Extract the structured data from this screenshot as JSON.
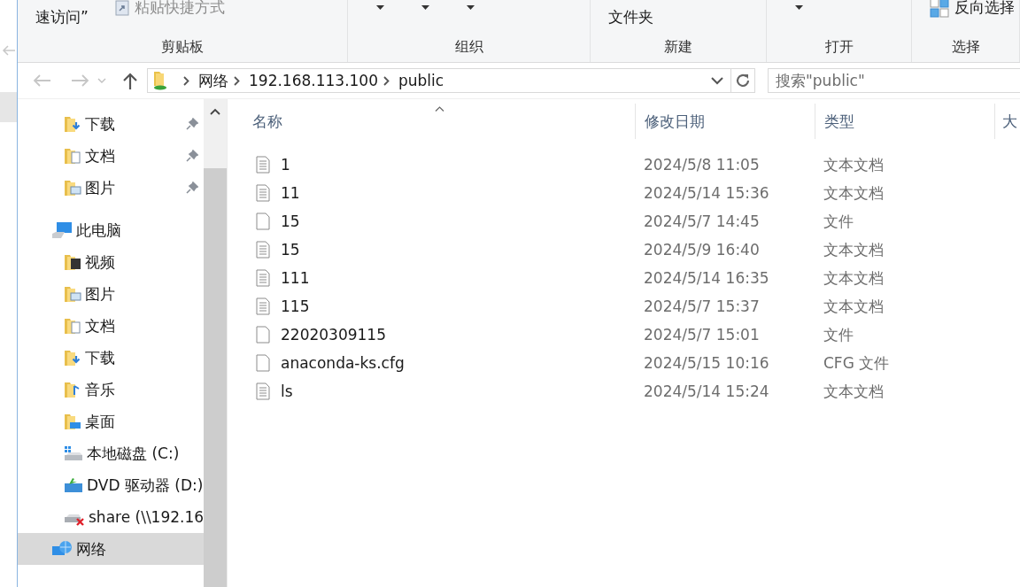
{
  "ribbon": {
    "groups": [
      {
        "label": "剪贴板",
        "items": [
          {
            "kind": "text",
            "label": "速访问”",
            "disabled": false
          },
          {
            "kind": "shortcut",
            "label": "粘贴快捷方式",
            "disabled": true
          }
        ]
      },
      {
        "label": "组织",
        "items": [
          {
            "kind": "caret"
          },
          {
            "kind": "caret"
          },
          {
            "kind": "caret"
          }
        ]
      },
      {
        "label": "新建",
        "items": [
          {
            "kind": "text",
            "label": "文件夹",
            "disabled": false
          }
        ]
      },
      {
        "label": "打开",
        "items": [
          {
            "kind": "caret"
          }
        ]
      },
      {
        "label": "选择",
        "items": [
          {
            "kind": "invert",
            "label": "反向选择",
            "disabled": false
          }
        ]
      }
    ]
  },
  "address": {
    "back_disabled": true,
    "forward_disabled": true,
    "crumbs": [
      "网络",
      "192.168.113.100",
      "public"
    ],
    "search": {
      "placeholder": "搜索\"public\""
    }
  },
  "nav": {
    "quick_access": [
      {
        "label": "下载",
        "kind": "download",
        "pinned": true
      },
      {
        "label": "文档",
        "kind": "document",
        "pinned": true
      },
      {
        "label": "图片",
        "kind": "picture",
        "pinned": true
      }
    ],
    "tree": [
      {
        "label": "此电脑",
        "kind": "computer",
        "selected": false,
        "children": [
          {
            "label": "视频",
            "kind": "video",
            "selected": false
          },
          {
            "label": "图片",
            "kind": "picture",
            "selected": false
          },
          {
            "label": "文档",
            "kind": "document",
            "selected": false
          },
          {
            "label": "下载",
            "kind": "download",
            "selected": false
          },
          {
            "label": "音乐",
            "kind": "music",
            "selected": false
          },
          {
            "label": "桌面",
            "kind": "desktop",
            "selected": false
          },
          {
            "label": "本地磁盘 (C:)",
            "kind": "drive",
            "selected": false
          },
          {
            "label": "DVD 驱动器 (D:)",
            "kind": "dvd",
            "selected": false
          },
          {
            "label": "share (\\\\192.16",
            "kind": "share",
            "selected": false
          }
        ]
      },
      {
        "label": "网络",
        "kind": "network",
        "selected": true
      }
    ]
  },
  "table": {
    "columns": [
      "名称",
      "修改日期",
      "类型",
      "大"
    ],
    "rows": [
      {
        "kind": "text",
        "name": "1",
        "date": "2024/5/8 11:05",
        "type": "文本文档"
      },
      {
        "kind": "text",
        "name": "11",
        "date": "2024/5/14 15:36",
        "type": "文本文档"
      },
      {
        "kind": "blank",
        "name": "15",
        "date": "2024/5/7 14:45",
        "type": "文件"
      },
      {
        "kind": "text",
        "name": "15",
        "date": "2024/5/9 16:40",
        "type": "文本文档"
      },
      {
        "kind": "text",
        "name": "111",
        "date": "2024/5/14 16:35",
        "type": "文本文档"
      },
      {
        "kind": "text",
        "name": "115",
        "date": "2024/5/7 15:37",
        "type": "文本文档"
      },
      {
        "kind": "blank",
        "name": "22020309115",
        "date": "2024/5/7 15:01",
        "type": "文件"
      },
      {
        "kind": "blank",
        "name": "anaconda-ks.cfg",
        "date": "2024/5/15 10:16",
        "type": "CFG 文件"
      },
      {
        "kind": "text",
        "name": "ls",
        "date": "2024/5/14 15:24",
        "type": "文本文档"
      }
    ]
  }
}
